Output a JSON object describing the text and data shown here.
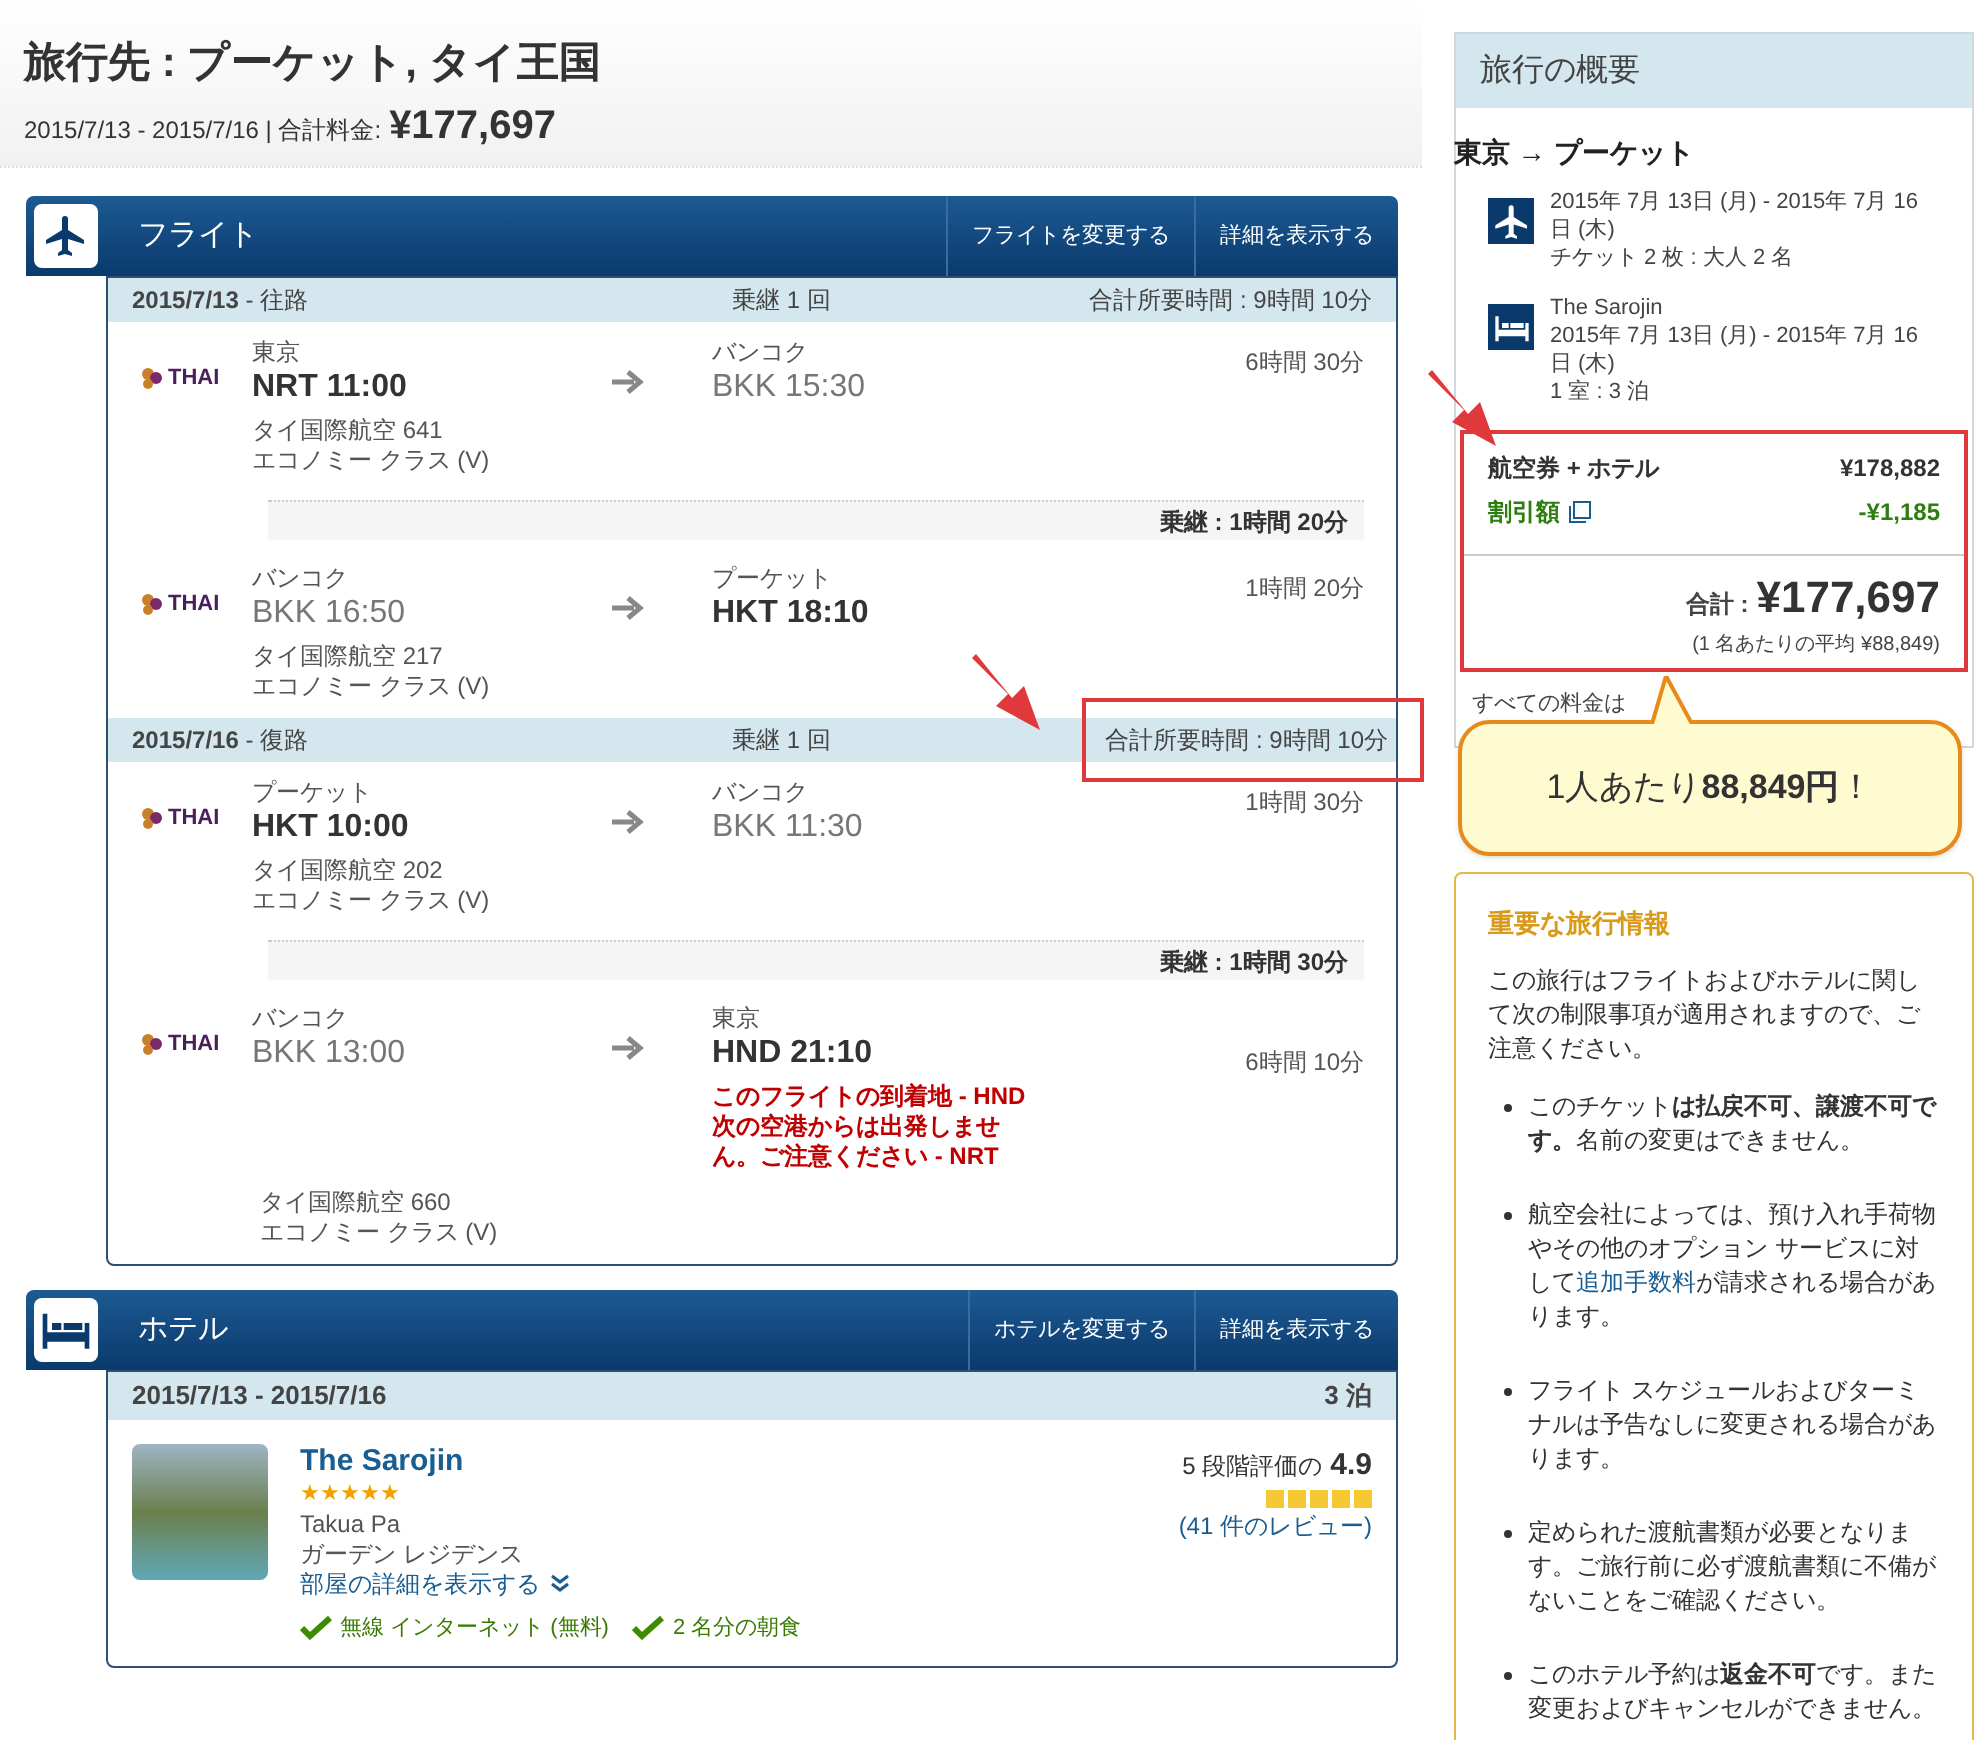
{
  "header": {
    "title": "旅行先 : プーケット, タイ王国",
    "dates": "2015/7/13 - 2015/7/16 | 合計料金:",
    "total": "¥177,697"
  },
  "flights": {
    "title": "フライト",
    "buttons": [
      "フライトを変更する",
      "詳細を表示する"
    ],
    "legs": [
      {
        "date": "**2015/7/13** - 往路",
        "stops": "乗継 1 回",
        "total_time": "合計所要時間 : 9時間 10分",
        "highlighted": false,
        "items": [
          {
            "kind": "segment",
            "airline": "THAI",
            "from_city": "東京",
            "from_time": "NRT 11:00",
            "from_bold": true,
            "to_city": "バンコク",
            "to_time": "BKK 15:30",
            "to_bold": false,
            "flight_no": "タイ国際航空 641",
            "cabin": "エコノミー クラス (V)",
            "duration": "6時間 30分"
          },
          {
            "kind": "layover",
            "label": "乗継 : 1時間 20分"
          },
          {
            "kind": "segment",
            "airline": "THAI",
            "from_city": "バンコク",
            "from_time": "BKK 16:50",
            "from_bold": false,
            "to_city": "プーケット",
            "to_time": "HKT 18:10",
            "to_bold": true,
            "flight_no": "タイ国際航空 217",
            "cabin": "エコノミー クラス (V)",
            "duration": "1時間 20分"
          }
        ]
      },
      {
        "date": "**2015/7/16** - 復路",
        "stops": "乗継 1 回",
        "total_time": "合計所要時間 : 9時間 10分",
        "highlighted": true,
        "items": [
          {
            "kind": "segment",
            "airline": "THAI",
            "from_city": "プーケット",
            "from_time": "HKT 10:00",
            "from_bold": true,
            "to_city": "バンコク",
            "to_time": "BKK 11:30",
            "to_bold": false,
            "flight_no": "タイ国際航空 202",
            "cabin": "エコノミー クラス (V)",
            "duration": "1時間 30分"
          },
          {
            "kind": "layover",
            "label": "乗継 : 1時間 30分"
          },
          {
            "kind": "segment",
            "airline": "THAI",
            "from_city": "バンコク",
            "from_time": "BKK 13:00",
            "from_bold": false,
            "to_city": "東京",
            "to_time": "HND 21:10",
            "to_bold": true,
            "warning": "このフライトの到着地 - HND 次の空港からは出発しません。ご注意ください - NRT",
            "flight_no": "タイ国際航空 660",
            "cabin": "エコノミー クラス (V)",
            "duration": "6時間 10分"
          }
        ]
      }
    ]
  },
  "hotel": {
    "title": "ホテル",
    "buttons": [
      "ホテルを変更する",
      "詳細を表示する"
    ],
    "dates": "2015/7/13 - 2015/7/16",
    "nights": "3 泊",
    "name": "The Sarojin",
    "stars": 5,
    "area": "Takua Pa",
    "room": "ガーデン レジデンス",
    "details_link": "部屋の詳細を表示する",
    "review": {
      "label": "5 段階評価の",
      "score": "4.9",
      "stars": 5,
      "count": "(41 件のレビュー)"
    },
    "amenities": [
      "無線 インターネット (無料)",
      "2 名分の朝食"
    ]
  },
  "summary": {
    "title": "旅行の概要",
    "route": "東京 → プーケット",
    "items": [
      {
        "kind": "flight",
        "lines": [
          "2015年 7月 13日 (月) - 2015年 7月 16日 (木)",
          "チケット 2 枚 : 大人 2 名"
        ]
      },
      {
        "kind": "hotel",
        "lines": [
          "The Sarojin",
          "2015年 7月 13日 (月) - 2015年 7月 16日 (木)",
          "1 室 : 3 泊"
        ]
      }
    ],
    "price_rows": [
      {
        "kind": "base",
        "label": "航空券 + ホテル",
        "amount": "¥178,882"
      },
      {
        "kind": "discount",
        "label": "割引額",
        "amount": "-¥1,185"
      }
    ],
    "total_label": "合計 :",
    "total": "¥177,697",
    "per_person": "(1 名あたりの平均 ¥88,849)",
    "note": "すべての料金は",
    "callout": "1人あたり**88,849円**！"
  },
  "info": {
    "title": "重要な旅行情報",
    "intro": "この旅行はフライトおよびホテルに関して次の制限事項が適用されますので、ご注意ください。",
    "bullets": [
      {
        "text": "このチケット**は払戻不可、譲渡不可です。**名前の変更はできません。"
      },
      {
        "text": "航空会社によっては、預け入れ手荷物やその他のオプション サービスに対して",
        "link": "追加手数料",
        "after": "が請求される場合があります。"
      },
      {
        "text": "フライト スケジュールおよびターミナルは予告なしに変更される場合があります。"
      },
      {
        "text": "定められた渡航書類が必要となります。ご旅行前に必ず渡航書類に不備がないことをご確認ください。"
      },
      {
        "text": "このホテル予約は**返金不可**です。また変更およびキャンセルができません。"
      }
    ]
  }
}
